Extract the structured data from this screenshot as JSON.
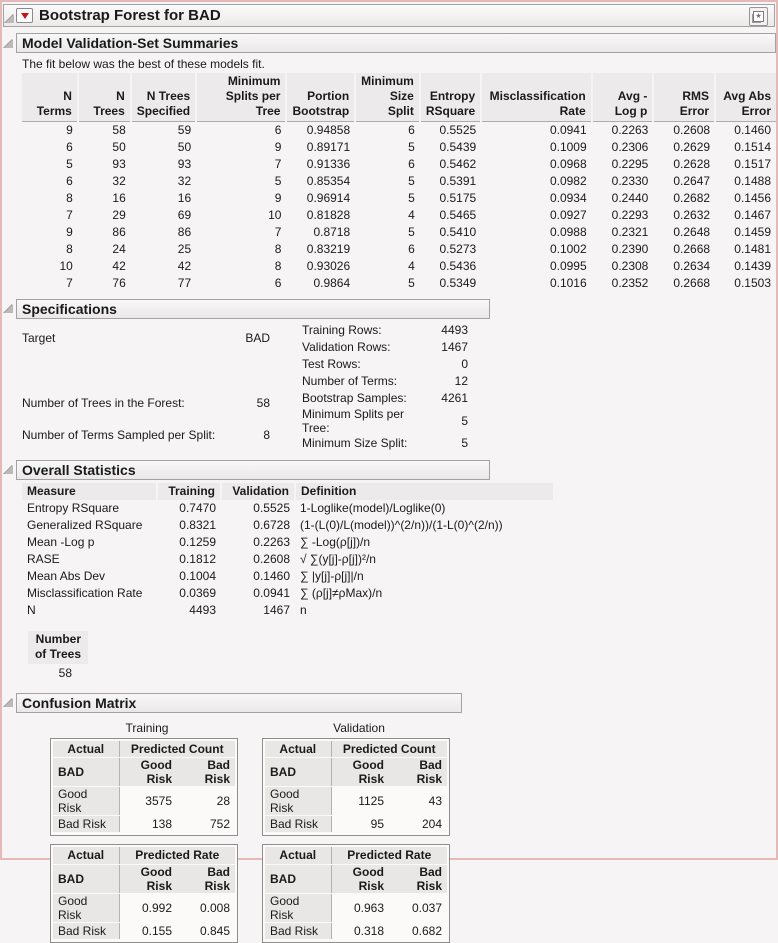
{
  "window": {
    "title": "Bootstrap Forest for BAD"
  },
  "sections": {
    "summaries": {
      "title": "Model Validation-Set Summaries",
      "caption": "The fit below was the best of these models fit.",
      "table": {
        "headers": [
          "N Terms",
          "N Trees",
          "N Trees\nSpecified",
          "Minimum\nSplits per Tree",
          "Portion\nBootstrap",
          "Minimum\nSize Split",
          "Entropy\nRSquare",
          "Misclassification\nRate",
          "Avg -Log p",
          "RMS Error",
          "Avg Abs\nError"
        ],
        "rows": [
          [
            "9",
            "58",
            "59",
            "6",
            "0.94858",
            "6",
            "0.5525",
            "0.0941",
            "0.2263",
            "0.2608",
            "0.1460"
          ],
          [
            "6",
            "50",
            "50",
            "9",
            "0.89171",
            "5",
            "0.5439",
            "0.1009",
            "0.2306",
            "0.2629",
            "0.1514"
          ],
          [
            "5",
            "93",
            "93",
            "7",
            "0.91336",
            "6",
            "0.5462",
            "0.0968",
            "0.2295",
            "0.2628",
            "0.1517"
          ],
          [
            "6",
            "32",
            "32",
            "5",
            "0.85354",
            "5",
            "0.5391",
            "0.0982",
            "0.2330",
            "0.2647",
            "0.1488"
          ],
          [
            "8",
            "16",
            "16",
            "9",
            "0.96914",
            "5",
            "0.5175",
            "0.0934",
            "0.2440",
            "0.2682",
            "0.1456"
          ],
          [
            "7",
            "29",
            "69",
            "10",
            "0.81828",
            "4",
            "0.5465",
            "0.0927",
            "0.2293",
            "0.2632",
            "0.1467"
          ],
          [
            "9",
            "86",
            "86",
            "7",
            "0.8718",
            "5",
            "0.5410",
            "0.0988",
            "0.2321",
            "0.2648",
            "0.1459"
          ],
          [
            "8",
            "24",
            "25",
            "8",
            "0.83219",
            "6",
            "0.5273",
            "0.1002",
            "0.2390",
            "0.2668",
            "0.1481"
          ],
          [
            "10",
            "42",
            "42",
            "8",
            "0.93026",
            "4",
            "0.5436",
            "0.0995",
            "0.2308",
            "0.2634",
            "0.1439"
          ],
          [
            "7",
            "76",
            "77",
            "6",
            "0.9864",
            "5",
            "0.5349",
            "0.1016",
            "0.2352",
            "0.2668",
            "0.1503"
          ]
        ]
      }
    },
    "specifications": {
      "title": "Specifications",
      "left_rows": [
        [
          "Target",
          "BAD"
        ],
        [
          "",
          ""
        ],
        [
          "Number of Trees in the Forest:",
          "58"
        ],
        [
          "Number of Terms Sampled per Split:",
          "8"
        ]
      ],
      "right_rows": [
        [
          "Training Rows:",
          "4493"
        ],
        [
          "Validation Rows:",
          "1467"
        ],
        [
          "Test Rows:",
          "0"
        ],
        [
          "Number of Terms:",
          "12"
        ],
        [
          "Bootstrap Samples:",
          "4261"
        ],
        [
          "Minimum Splits per Tree:",
          "5"
        ],
        [
          "Minimum Size Split:",
          "5"
        ]
      ]
    },
    "overall": {
      "title": "Overall Statistics",
      "headers": [
        "Measure",
        "Training",
        "Validation",
        "Definition"
      ],
      "rows": [
        [
          "Entropy RSquare",
          "0.7470",
          "0.5525",
          "1-Loglike(model)/Loglike(0)"
        ],
        [
          "Generalized RSquare",
          "0.8321",
          "0.6728",
          "(1-(L(0)/L(model))^(2/n))/(1-L(0)^(2/n))"
        ],
        [
          "Mean -Log p",
          "0.1259",
          "0.2263",
          "∑ -Log(ρ[j])/n"
        ],
        [
          "RASE",
          "0.1812",
          "0.2608",
          "√ ∑(y[j]-ρ[j])²/n"
        ],
        [
          "Mean Abs Dev",
          "0.1004",
          "0.1460",
          "∑ |y[j]-ρ[j]|/n"
        ],
        [
          "Misclassification Rate",
          "0.0369",
          "0.0941",
          "∑ (ρ[j]≠ρMax)/n"
        ],
        [
          "N",
          "4493",
          "1467",
          "n"
        ]
      ],
      "n_trees": {
        "header": "Number\nof Trees",
        "value": "58"
      }
    },
    "confusion": {
      "title": "Confusion Matrix",
      "training_label": "Training",
      "validation_label": "Validation",
      "actual_label": "Actual",
      "response_label": "BAD",
      "predicted_count_label": "Predicted Count",
      "predicted_rate_label": "Predicted Rate",
      "good_risk_label": "Good Risk",
      "bad_risk_label": "Bad Risk",
      "training_count_rows": [
        [
          "Good Risk",
          "3575",
          "28"
        ],
        [
          "Bad Risk",
          "138",
          "752"
        ]
      ],
      "validation_count_rows": [
        [
          "Good Risk",
          "1125",
          "43"
        ],
        [
          "Bad Risk",
          "95",
          "204"
        ]
      ],
      "training_rate_rows": [
        [
          "Good Risk",
          "0.992",
          "0.008"
        ],
        [
          "Bad Risk",
          "0.155",
          "0.845"
        ]
      ],
      "validation_rate_rows": [
        [
          "Good Risk",
          "0.963",
          "0.037"
        ],
        [
          "Bad Risk",
          "0.318",
          "0.682"
        ]
      ]
    }
  }
}
